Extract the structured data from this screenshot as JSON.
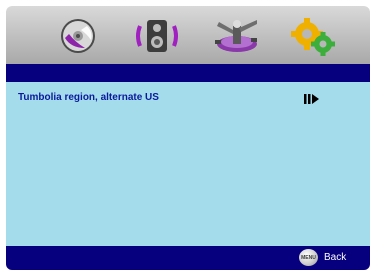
{
  "toolbar": {
    "icons": [
      "disc-icon",
      "speaker-icon",
      "antenna-icon",
      "gears-icon"
    ]
  },
  "settings": {
    "items": [
      {
        "label": "Tumbolia region, alternate US",
        "indicator": "submenu-arrow-icon"
      }
    ]
  },
  "footer": {
    "menu_button_text": "MENU",
    "back_label": "Back"
  },
  "colors": {
    "header_bar": "#06007f",
    "content_bg": "#a4dcec",
    "item_text": "#0b1a9c"
  }
}
